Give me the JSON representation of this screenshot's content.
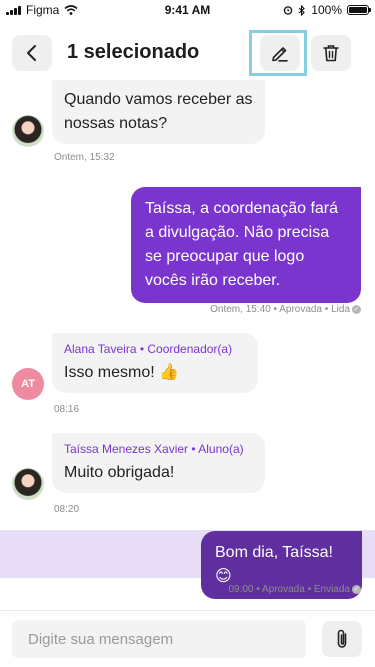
{
  "status_bar": {
    "carrier": "Figma",
    "time": "9:41 AM",
    "battery": "100%"
  },
  "header": {
    "title": "1 selecionado",
    "back_icon": "chevron-left-icon",
    "edit_icon": "pencil-icon",
    "delete_icon": "trash-icon"
  },
  "messages": [
    {
      "direction": "in",
      "text": "Quando vamos receber as nossas notas?",
      "meta": "Ontem, 15:32",
      "avatar": "photo"
    },
    {
      "direction": "out",
      "text": "Taíssa, a coordenação fará a divulgação. Não precisa se preocupar que logo vocês irão receber.",
      "meta": "Ontem, 15:40 • Aprovada • Lida"
    },
    {
      "direction": "in",
      "sender": "Alana Taveira • Coordenador(a)",
      "text": "Isso mesmo! 👍",
      "meta": "08:16",
      "avatar_initials": "AT"
    },
    {
      "direction": "in",
      "sender": "Taíssa Menezes Xavier • Aluno(a)",
      "text": "Muito obrigada!",
      "meta": "08:20",
      "avatar": "photo"
    },
    {
      "direction": "out",
      "text": "Bom dia, Taíssa! 😊",
      "meta": "09:00 • Aprovada • Enviada",
      "selected": true
    }
  ],
  "composer": {
    "placeholder": "Digite sua mensagem",
    "value": "",
    "attach_icon": "paperclip-icon"
  },
  "colors": {
    "accent": "#7b35cf",
    "selected_bubble": "#5f2fa0",
    "selected_row": "#e8ddf7",
    "edit_highlight": "#86cfe0"
  }
}
